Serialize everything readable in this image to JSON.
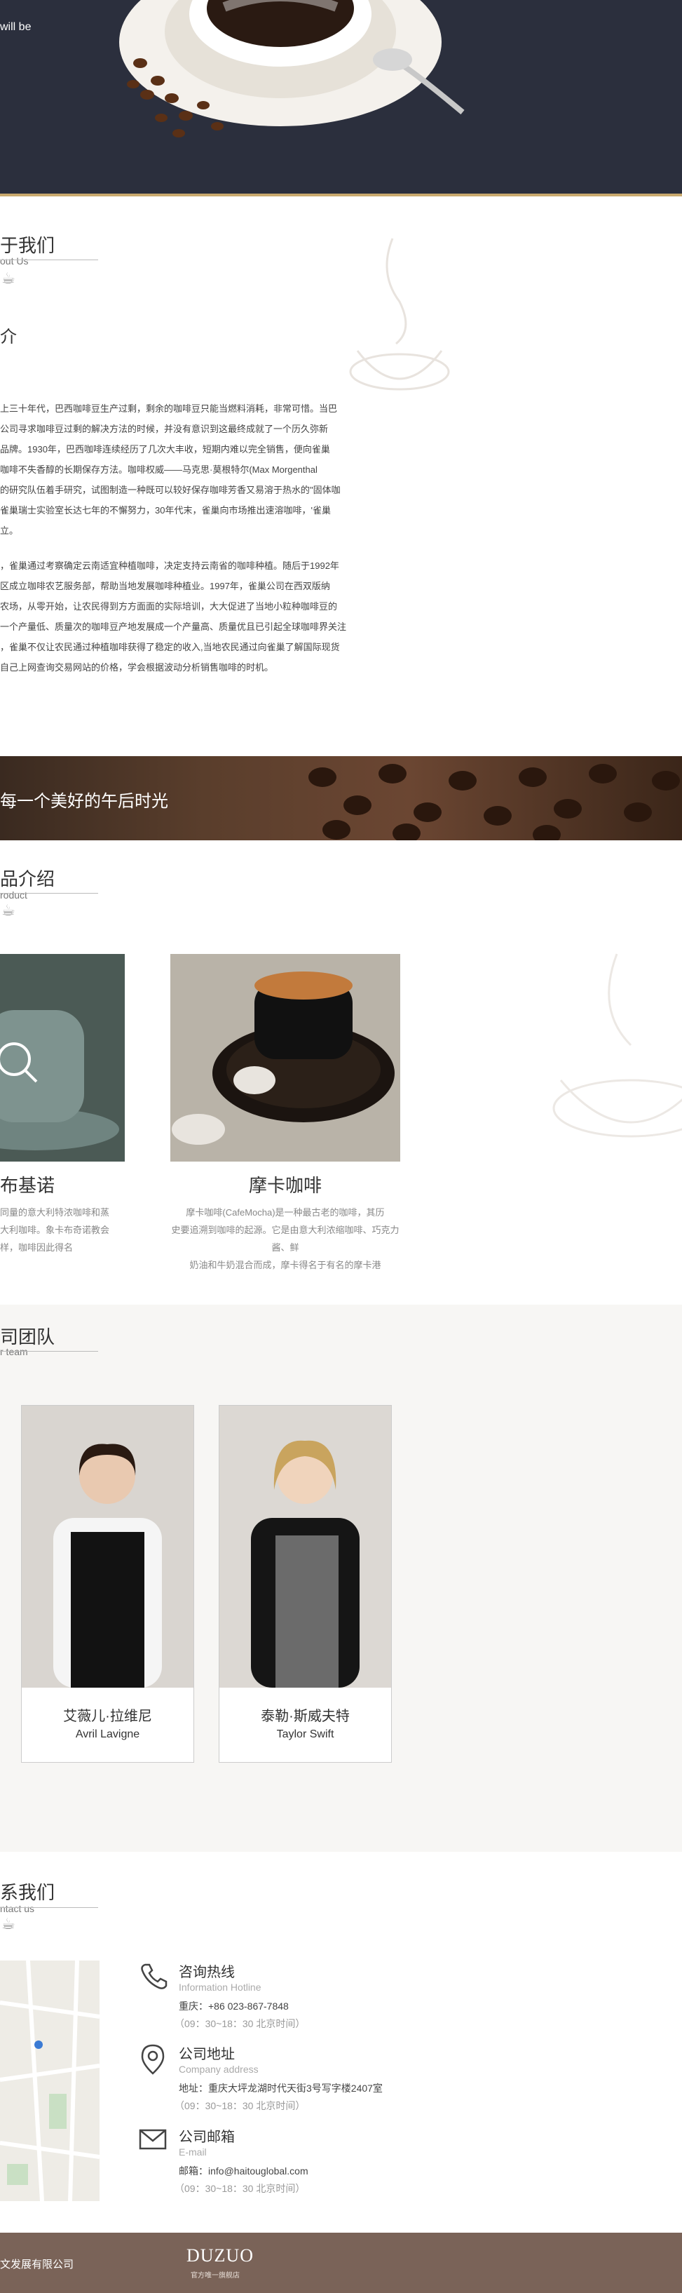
{
  "hero": {
    "text": "will be"
  },
  "about": {
    "title": "于我们",
    "subtitle": "out Us",
    "heading": "介",
    "paragraph1": [
      "上三十年代，巴西咖啡豆生产过剩，剩余的咖啡豆只能当燃料消耗，非常可惜。当巴",
      "公司寻求咖啡豆过剩的解决方法的时候，并没有意识到这最终成就了一个历久弥新",
      "品牌。1930年，巴西咖啡连续经历了几次大丰收，短期内难以完全销售，便向雀巢",
      "咖啡不失香醇的长期保存方法。咖啡权威——马克思·莫根特尔(Max Morgenthal",
      "的研究队伍着手研究，试图制造一种既可以较好保存咖啡芳香又易溶于热水的\"固体咖",
      "雀巢瑞士实验室长达七年的不懈努力，30年代末，雀巢向市场推出速溶咖啡，'雀巢",
      "立。"
    ],
    "paragraph2": [
      "，雀巢通过考察确定云南适宜种植咖啡，决定支持云南省的咖啡种植。随后于1992年",
      "区成立咖啡农艺服务部，帮助当地发展咖啡种植业。1997年，雀巢公司在西双版纳",
      "农场，从零开始，让农民得到方方面面的实际培训，大大促进了当地小粒种咖啡豆的",
      "一个产量低、质量次的咖啡豆产地发展成一个产量高、质量优且已引起全球咖啡界关注",
      "，雀巢不仅让农民通过种植咖啡获得了稳定的收入,当地农民通过向雀巢了解国际现货",
      "自己上网查询交易网站的价格，学会根据波动分析销售咖啡的时机。"
    ]
  },
  "banner": {
    "text": "每一个美好的午后时光"
  },
  "products": {
    "title": "品介绍",
    "subtitle": "roduct",
    "items": [
      {
        "name": "布基诺",
        "desc": [
          "同量的意大利特浓咖啡和蒸",
          "大利咖啡。象卡布奇诺教会",
          "样，咖啡因此得名"
        ]
      },
      {
        "name": "摩卡咖啡",
        "desc": [
          "摩卡咖啡(CafeMocha)是一种最古老的咖啡，其历",
          "史要追溯到咖啡的起源。它是由意大利浓缩咖啡、巧克力酱、鲜",
          "奶油和牛奶混合而成，摩卡得名于有名的摩卡港"
        ]
      }
    ]
  },
  "team": {
    "title": "司团队",
    "subtitle": "r team",
    "members": [
      {
        "name": "艾薇儿·拉维尼",
        "en": "Avril Lavigne"
      },
      {
        "name": "泰勒·斯威夫特",
        "en": "Taylor Swift"
      }
    ]
  },
  "contact": {
    "title": "系我们",
    "subtitle": "ntact us",
    "items": [
      {
        "icon": "phone-icon",
        "title": "咨询热线",
        "en": "Information Hotline",
        "line": "重庆：+86 023-867-7848",
        "hours": "（09：30~18：30 北京时间）"
      },
      {
        "icon": "location-pin-icon",
        "title": "公司地址",
        "en": "Company address",
        "line": "地址：重庆大坪龙湖时代天街3号写字楼2407室",
        "hours": "（09：30~18：30 北京时间）"
      },
      {
        "icon": "mail-icon",
        "title": "公司邮箱",
        "en": "E-mail",
        "line": "邮箱：info@haitouglobal.com",
        "hours": "（09：30~18：30 北京时间）"
      }
    ]
  },
  "footer": {
    "company": "文发展有限公司",
    "logo": "DUZUO",
    "logo_sub": "官方唯一旗舰店"
  },
  "colors": {
    "hero_bg": "#2b2f3d",
    "footer_bg": "#7a6358",
    "accent_gold": "#c9a96e"
  }
}
